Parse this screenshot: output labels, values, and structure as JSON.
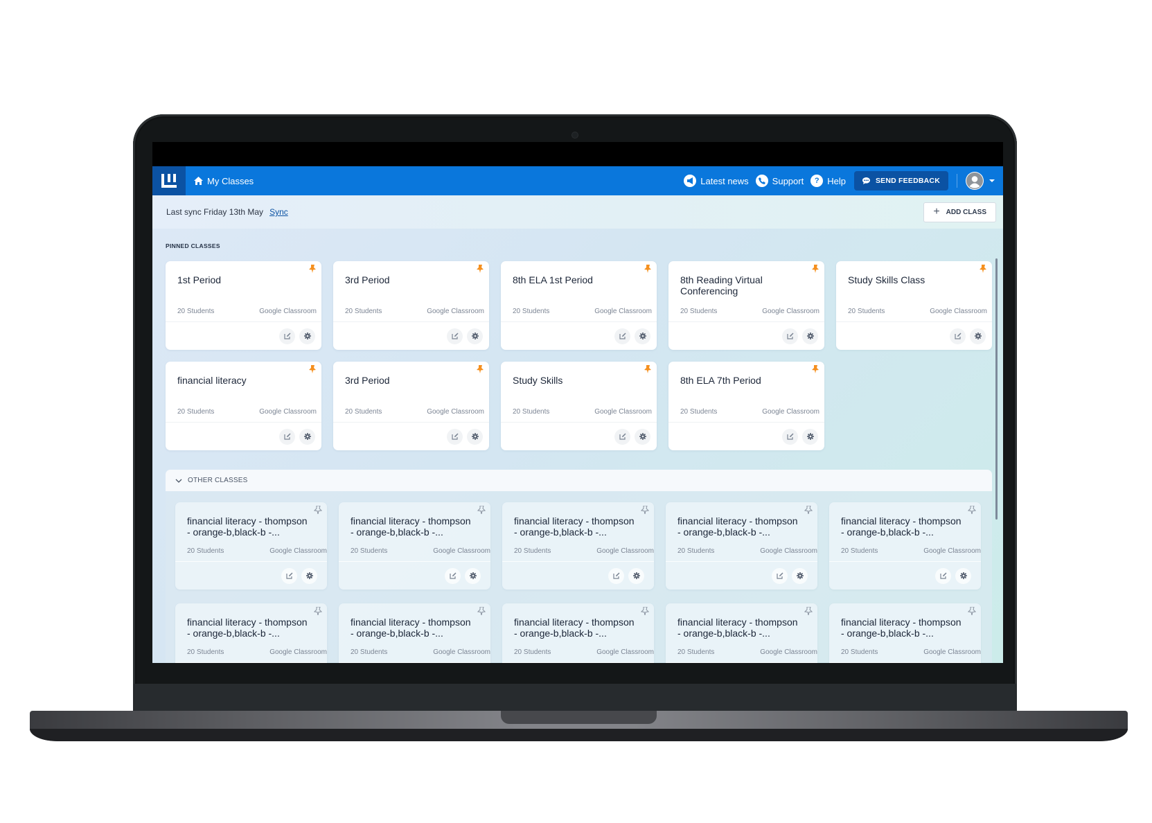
{
  "header": {
    "nav_home": "My Classes",
    "links": [
      {
        "label": "Latest news",
        "icon": "megaphone-icon"
      },
      {
        "label": "Support",
        "icon": "phone-icon"
      },
      {
        "label": "Help",
        "icon": "help-icon"
      }
    ],
    "feedback_label": "SEND FEEDBACK"
  },
  "syncbar": {
    "last_sync": "Last sync Friday 13th May",
    "sync_link": "Sync",
    "add_class": "ADD CLASS"
  },
  "pinned": {
    "label": "PINNED CLASSES",
    "cards": [
      {
        "title": "1st Period",
        "students": "20 Students",
        "source": "Google Classroom"
      },
      {
        "title": "3rd Period",
        "students": "20 Students",
        "source": "Google Classroom"
      },
      {
        "title": "8th ELA 1st Period",
        "students": "20 Students",
        "source": "Google Classroom"
      },
      {
        "title": "8th Reading Virtual Conferencing",
        "students": "20 Students",
        "source": "Google Classroom"
      },
      {
        "title": "Study Skills Class",
        "students": "20 Students",
        "source": "Google Classroom"
      },
      {
        "title": "financial literacy",
        "students": "20 Students",
        "source": "Google Classroom"
      },
      {
        "title": "3rd Period",
        "students": "20 Students",
        "source": "Google Classroom"
      },
      {
        "title": "Study Skills",
        "students": "20 Students",
        "source": "Google Classroom"
      },
      {
        "title": "8th ELA 7th Period",
        "students": "20 Students",
        "source": "Google Classroom"
      }
    ]
  },
  "other": {
    "label": "OTHER CLASSES",
    "cards": [
      {
        "title": "financial literacy - thompson - orange-b,black-b -...",
        "students": "20 Students",
        "source": "Google Classroom"
      },
      {
        "title": "financial literacy - thompson - orange-b,black-b -...",
        "students": "20 Students",
        "source": "Google Classroom"
      },
      {
        "title": "financial literacy - thompson - orange-b,black-b -...",
        "students": "20 Students",
        "source": "Google Classroom"
      },
      {
        "title": "financial literacy - thompson - orange-b,black-b -...",
        "students": "20 Students",
        "source": "Google Classroom"
      },
      {
        "title": "financial literacy - thompson - orange-b,black-b -...",
        "students": "20 Students",
        "source": "Google Classroom"
      },
      {
        "title": "financial literacy - thompson - orange-b,black-b -...",
        "students": "20 Students",
        "source": "Google Classroom"
      },
      {
        "title": "financial literacy - thompson - orange-b,black-b -...",
        "students": "20 Students",
        "source": "Google Classroom"
      },
      {
        "title": "financial literacy - thompson - orange-b,black-b -...",
        "students": "20 Students",
        "source": "Google Classroom"
      },
      {
        "title": "financial literacy - thompson - orange-b,black-b -...",
        "students": "20 Students",
        "source": "Google Classroom"
      },
      {
        "title": "financial literacy - thompson - orange-b,black-b -...",
        "students": "20 Students",
        "source": "Google Classroom"
      }
    ]
  },
  "colors": {
    "brand_blue": "#0a77dc",
    "brand_dark": "#0b52a3",
    "pin_active": "#f5901f"
  }
}
